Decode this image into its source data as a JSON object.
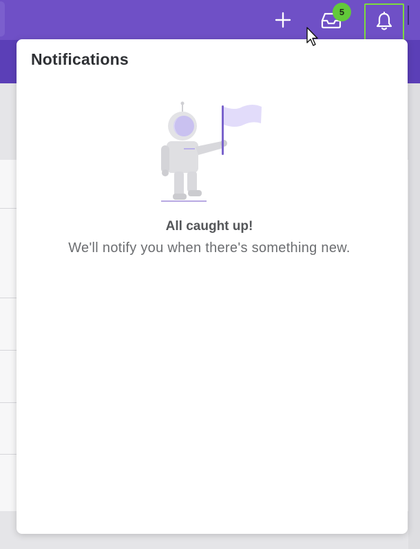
{
  "topbar": {
    "add_icon": "plus-icon",
    "inbox_icon": "inbox-tray-icon",
    "inbox_badge": "5",
    "bell_icon": "bell-icon",
    "brand_color": "#6f50c6",
    "badge_color": "#62c93a",
    "focus_outline_color": "#7ddc3d"
  },
  "notifications": {
    "title": "Notifications",
    "illustration": "astronaut-with-flag-illustration",
    "empty_heading": "All caught up!",
    "empty_message": "We'll notify you when there's something new."
  },
  "cursor": {
    "icon": "arrow-cursor-icon"
  }
}
